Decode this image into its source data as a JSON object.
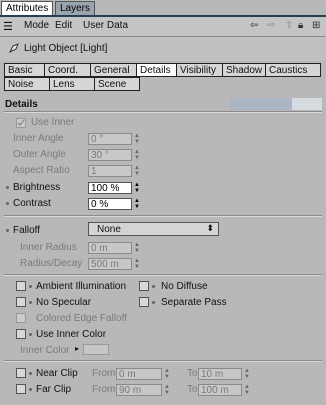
{
  "top_tabs": {
    "attributes": "Attributes",
    "layers": "Layers"
  },
  "menu": {
    "mode": "Mode",
    "edit": "Edit",
    "user_data": "User Data"
  },
  "object": {
    "title": "Light Object [Light]"
  },
  "tabs": {
    "row1": [
      "Basic",
      "Coord.",
      "General",
      "Details",
      "Visibility",
      "Shadow",
      "Caustics"
    ],
    "row2": [
      "Noise",
      "Lens",
      "Scene"
    ],
    "active": "Details"
  },
  "details": {
    "section_title": "Details",
    "use_inner": "Use Inner",
    "inner_angle_label": "Inner Angle",
    "inner_angle_value": "0 °",
    "outer_angle_label": "Outer Angle",
    "outer_angle_value": "30 °",
    "aspect_ratio_label": "Aspect Ratio",
    "aspect_ratio_value": "1",
    "brightness_label": "Brightness",
    "brightness_value": "100 %",
    "contrast_label": "Contrast",
    "contrast_value": "0 %"
  },
  "falloff": {
    "label": "Falloff",
    "value": "None",
    "inner_radius_label": "Inner Radius",
    "inner_radius_value": "0 m",
    "radius_decay_label": "Radius/Decay",
    "radius_decay_value": "500 m"
  },
  "options": {
    "ambient_illumination": "Ambient Illumination",
    "no_diffuse": "No Diffuse",
    "no_specular": "No Specular",
    "separate_pass": "Separate Pass",
    "colored_edge_falloff": "Colored Edge Falloff",
    "use_inner_color": "Use Inner Color",
    "inner_color": "Inner Color"
  },
  "clip": {
    "near_clip": "Near Clip",
    "far_clip": "Far Clip",
    "from": "From",
    "to": "To",
    "near_from": "0 m",
    "near_to": "10 m",
    "far_from": "90 m",
    "far_to": "100 m"
  }
}
